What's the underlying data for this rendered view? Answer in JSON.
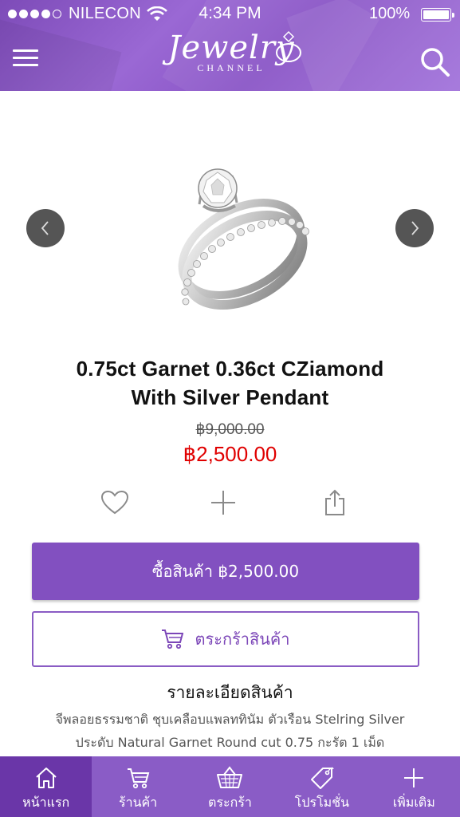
{
  "status_bar": {
    "carrier": "NILECON",
    "time": "4:34 PM",
    "battery": "100%",
    "icons": [
      "signal-dots-icon",
      "wifi-icon",
      "battery-icon"
    ]
  },
  "header": {
    "logo_script": "Jewelry",
    "logo_sub": "CHANNEL",
    "icons": [
      "menu-icon",
      "search-icon"
    ],
    "brand_color": "#8a55c6"
  },
  "product": {
    "image_icon": "ring-image",
    "title_line1": "0.75ct Garnet 0.36ct CZiamond",
    "title_line2": "With Silver Pendant",
    "price_original": "฿9,000.00",
    "price_sale": "฿2,500.00",
    "sale_color": "#e00000",
    "action_icons": [
      "heart-icon",
      "plus-icon",
      "share-icon"
    ]
  },
  "buttons": {
    "buy_label": "ซื้อสินค้า ฿2,500.00",
    "cart_label": "ตระกร้าสินค้า"
  },
  "details": {
    "heading": "รายละเอียดสินค้า",
    "line1": "จีพลอยธรรมชาติ ชุบเคลือบแพลททินัม ตัวเรือน Stelring Silver",
    "line2": "ประดับ Natural Garnet Round cut 0.75 กะรัต 1 เม็ด"
  },
  "tabbar": {
    "items": [
      {
        "label": "หน้าแรก",
        "icon": "home-icon",
        "active": true
      },
      {
        "label": "ร้านค้า",
        "icon": "cart-icon",
        "active": false
      },
      {
        "label": "ตระกร้า",
        "icon": "basket-icon",
        "active": false
      },
      {
        "label": "โปรโมชั่น",
        "icon": "tag-icon",
        "active": false
      },
      {
        "label": "เพิ่มเติม",
        "icon": "plus-icon",
        "active": false
      }
    ]
  }
}
